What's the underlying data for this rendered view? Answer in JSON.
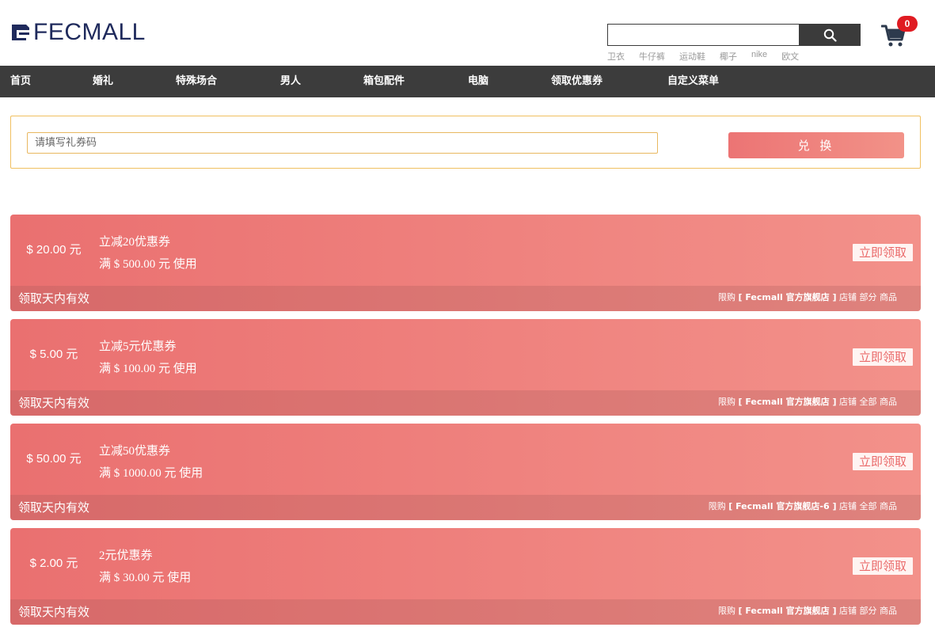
{
  "header": {
    "logo_text": "FECMALL",
    "search": {
      "placeholder": "",
      "button_icon": "search-icon"
    },
    "hotwords": [
      "卫衣",
      "牛仔裤",
      "运动鞋",
      "椰子",
      "nike",
      "欧文"
    ],
    "cart": {
      "icon": "cart-icon",
      "count": "0",
      "badge_color": "#e01b22"
    }
  },
  "nav": {
    "items": [
      {
        "label": "首页"
      },
      {
        "label": "婚礼"
      },
      {
        "label": "特殊场合"
      },
      {
        "label": "男人"
      },
      {
        "label": "箱包配件"
      },
      {
        "label": "电脑"
      },
      {
        "label": "领取优惠券"
      },
      {
        "label": "自定义菜单"
      }
    ],
    "background": "#3c3c3c"
  },
  "redeem": {
    "placeholder": "请填写礼券码",
    "button_label": "兑 换"
  },
  "coupons": [
    {
      "amount": "$ 20.00 元",
      "title": "立减20优惠券",
      "condition": "满 $ 500.00 元 使用",
      "action": "立即领取",
      "validity": "领取天内有效",
      "scope_prefix": "限购",
      "scope_store": "[ Fecmall 官方旗舰店 ]",
      "scope_suffix": "店铺 部分 商品"
    },
    {
      "amount": "$ 5.00 元",
      "title": "立减5元优惠券",
      "condition": "满 $ 100.00 元 使用",
      "action": "立即领取",
      "validity": "领取天内有效",
      "scope_prefix": "限购",
      "scope_store": "[ Fecmall 官方旗舰店 ]",
      "scope_suffix": "店铺 全部 商品"
    },
    {
      "amount": "$ 50.00 元",
      "title": "立减50优惠券",
      "condition": "满 $ 1000.00 元 使用",
      "action": "立即领取",
      "validity": "领取天内有效",
      "scope_prefix": "限购",
      "scope_store": "[ Fecmall 官方旗舰店-6 ]",
      "scope_suffix": "店铺 全部 商品"
    },
    {
      "amount": "$ 2.00 元",
      "title": "2元优惠券",
      "condition": "满 $ 30.00 元 使用",
      "action": "立即领取",
      "validity": "领取天内有效",
      "scope_prefix": "限购",
      "scope_store": "[ Fecmall 官方旗舰店 ]",
      "scope_suffix": "店铺 部分 商品"
    }
  ],
  "colors": {
    "coupon_gradient_start": "#ea7070",
    "coupon_gradient_end": "#f3918a",
    "accent_border": "#f0c060"
  }
}
